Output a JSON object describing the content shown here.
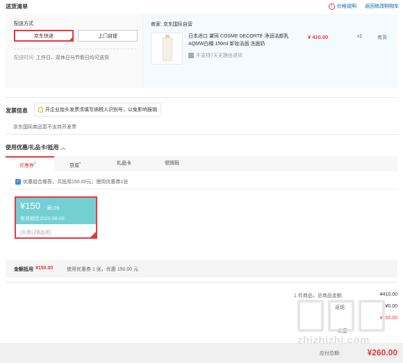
{
  "header": {
    "title": "送货清单",
    "price_info": "价格说明",
    "back_to_cart": "返回修改购物车"
  },
  "shipping": {
    "method_label": "配送方式",
    "option_selected": "京东快递",
    "option_pickup": "上门自提",
    "time_label": "配送时间:",
    "time_value": "工作日、双休日与节假日均可送货"
  },
  "seller": {
    "label": "商家:",
    "name": "京东国际自营"
  },
  "product": {
    "name_line1": "日本进口 黛珂 COSME DECORTE 净润洁颜乳",
    "name_line2": "AQMW白檀 150ml 卸妆洁面 洗面奶",
    "no_return": "不支持7天无理由退货",
    "price": "¥ 410.00",
    "qty": "x1",
    "stock": "有货"
  },
  "invoice": {
    "title": "发票信息",
    "tip": "开企业抬头发票须填写纳税人识别号，以免影响报销",
    "note": "京东国际商品暂不支持开发票"
  },
  "coupons": {
    "section_title": "使用优惠/礼品卡/抵用",
    "collapse": "︿",
    "tabs": [
      {
        "label": "优惠券",
        "badge": "•"
      },
      {
        "label": "京豆",
        "badge": "•"
      },
      {
        "label": "礼品卡",
        "badge": ""
      },
      {
        "label": "领货码",
        "badge": ""
      }
    ],
    "recommend_text": "优惠组合推荐，共抵用150.00元，使用优惠券1张",
    "card": {
      "amount": "¥150",
      "condition": "满199",
      "expiry": "有效期至2020-08-05",
      "tag1": "[东券]",
      "tag2": "[限品类]"
    },
    "summary_label": "金额抵用",
    "summary_amount": "¥150.00",
    "summary_detail": "使用优惠券 1 张，优惠 150.00 元"
  },
  "totals": {
    "items_label": "件商品，总商品金额:",
    "items_count": "1",
    "items_value": "¥410.00",
    "rebate_label": "返现:",
    "rebate_value": "¥0.00",
    "discount_value": "¥150.00",
    "coupon_label": "优惠",
    "payable_label": "应付总额:",
    "payable_value": "¥260.00"
  },
  "watermark": {
    "text": "zhizhizhi.com"
  },
  "colors": {
    "accent": "#e4393c",
    "coupon_bg": "#74cfd3",
    "link": "#005ea7"
  }
}
